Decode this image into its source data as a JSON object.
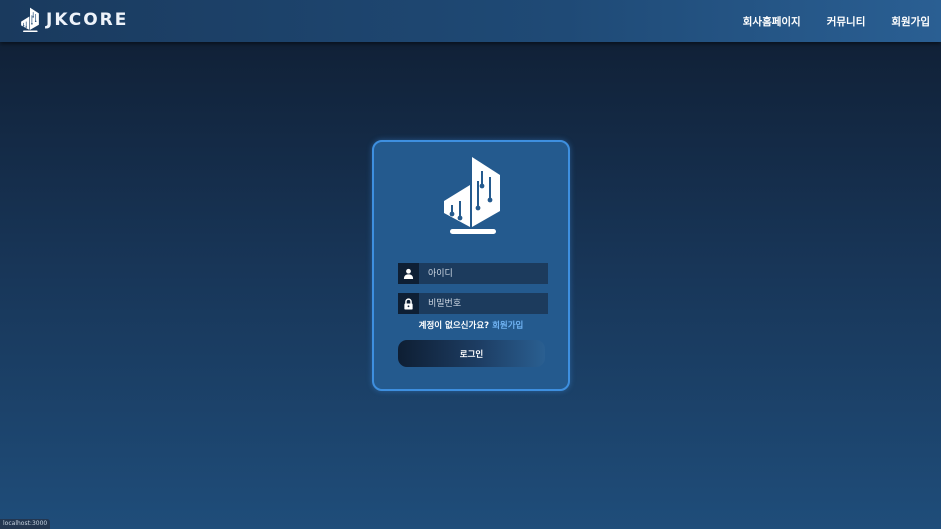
{
  "brand": {
    "name": "JKCORE",
    "logo_icon": "building-chip-logo"
  },
  "nav": {
    "items": [
      {
        "label": "회사홈페이지"
      },
      {
        "label": "커뮤니티"
      },
      {
        "label": "회원가입"
      }
    ]
  },
  "login": {
    "id_field": {
      "icon": "user-icon",
      "value": "",
      "placeholder": "아이디"
    },
    "password_field": {
      "icon": "lock-icon",
      "value": "",
      "placeholder": "비밀번호"
    },
    "signup_prompt": "계정이 없으신가요?",
    "signup_link": "회원가입",
    "submit_label": "로그인"
  },
  "status_bar": {
    "url": "localhost:3000"
  },
  "colors": {
    "header": "#1f4a76",
    "card_background": "#245a8e",
    "card_border": "#3e8fdf",
    "link": "#6fb2f2",
    "input_background": "#1c3b5d",
    "icon_box": "#0e1f34"
  }
}
